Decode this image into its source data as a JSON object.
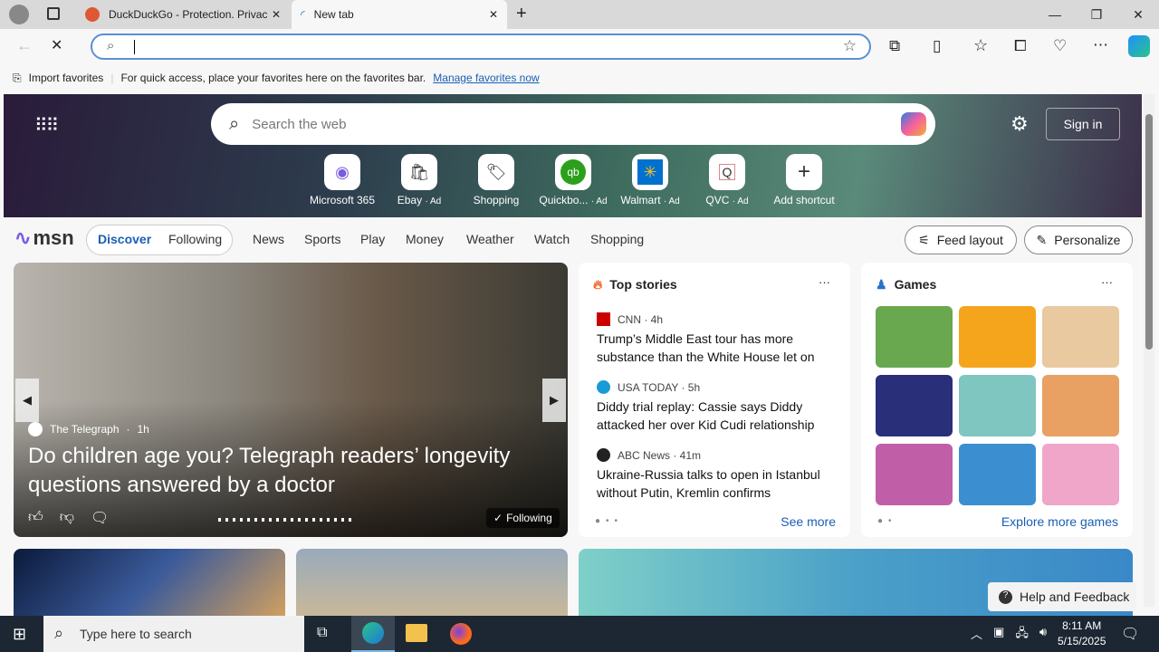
{
  "browser": {
    "tabs": [
      {
        "title": "DuckDuckGo - Protection. Privac"
      },
      {
        "title": "New tab"
      }
    ],
    "address": "",
    "fav_import": "Import favorites",
    "fav_msg": "For quick access, place your favorites here on the favorites bar.",
    "fav_link": "Manage favorites now"
  },
  "msn": {
    "search_placeholder": "Search the web",
    "sign_in": "Sign in",
    "shortcuts": [
      {
        "label": "Microsoft 365",
        "ad": ""
      },
      {
        "label": "Ebay",
        "ad": "· Ad"
      },
      {
        "label": "Shopping",
        "ad": ""
      },
      {
        "label": "Quickbo...",
        "ad": "· Ad"
      },
      {
        "label": "Walmart",
        "ad": "· Ad"
      },
      {
        "label": "QVC",
        "ad": "· Ad"
      },
      {
        "label": "Add shortcut",
        "ad": ""
      }
    ],
    "logo": "msn",
    "tabs": [
      "Discover",
      "Following"
    ],
    "nav": [
      "News",
      "Sports",
      "Play",
      "Money",
      "Weather",
      "Watch",
      "Shopping"
    ],
    "feed_layout": "Feed layout",
    "personalize": "Personalize",
    "hero": {
      "source": "The Telegraph",
      "age": "1h",
      "title": "Do children age you? Telegraph readers’ longevity questions answered by a doctor",
      "following": "Following"
    },
    "top_stories": {
      "title": "Top stories",
      "items": [
        {
          "source": "CNN · 4h",
          "headline": "Trump’s Middle East tour has more substance than the White House let on",
          "color": "#cc0000"
        },
        {
          "source": "USA TODAY · 5h",
          "headline": "Diddy trial replay: Cassie says Diddy attacked her over Kid Cudi relationship",
          "color": "#1a9ad6"
        },
        {
          "source": "ABC News · 41m",
          "headline": "Ukraine-Russia talks to open in Istanbul without Putin, Kremlin confirms",
          "color": "#222"
        }
      ],
      "see_more": "See more"
    },
    "games": {
      "title": "Games",
      "explore": "Explore more games",
      "tile_colors": [
        "#6aa84f",
        "#f4a51c",
        "#e9c9a0",
        "#2a2f7a",
        "#7fc6c0",
        "#e8a063",
        "#c05fa8",
        "#3b8fd0",
        "#f0a6c8"
      ]
    },
    "help": "Help and Feedback"
  },
  "taskbar": {
    "search": "Type here to search",
    "time": "8:11 AM",
    "date": "5/15/2025"
  }
}
